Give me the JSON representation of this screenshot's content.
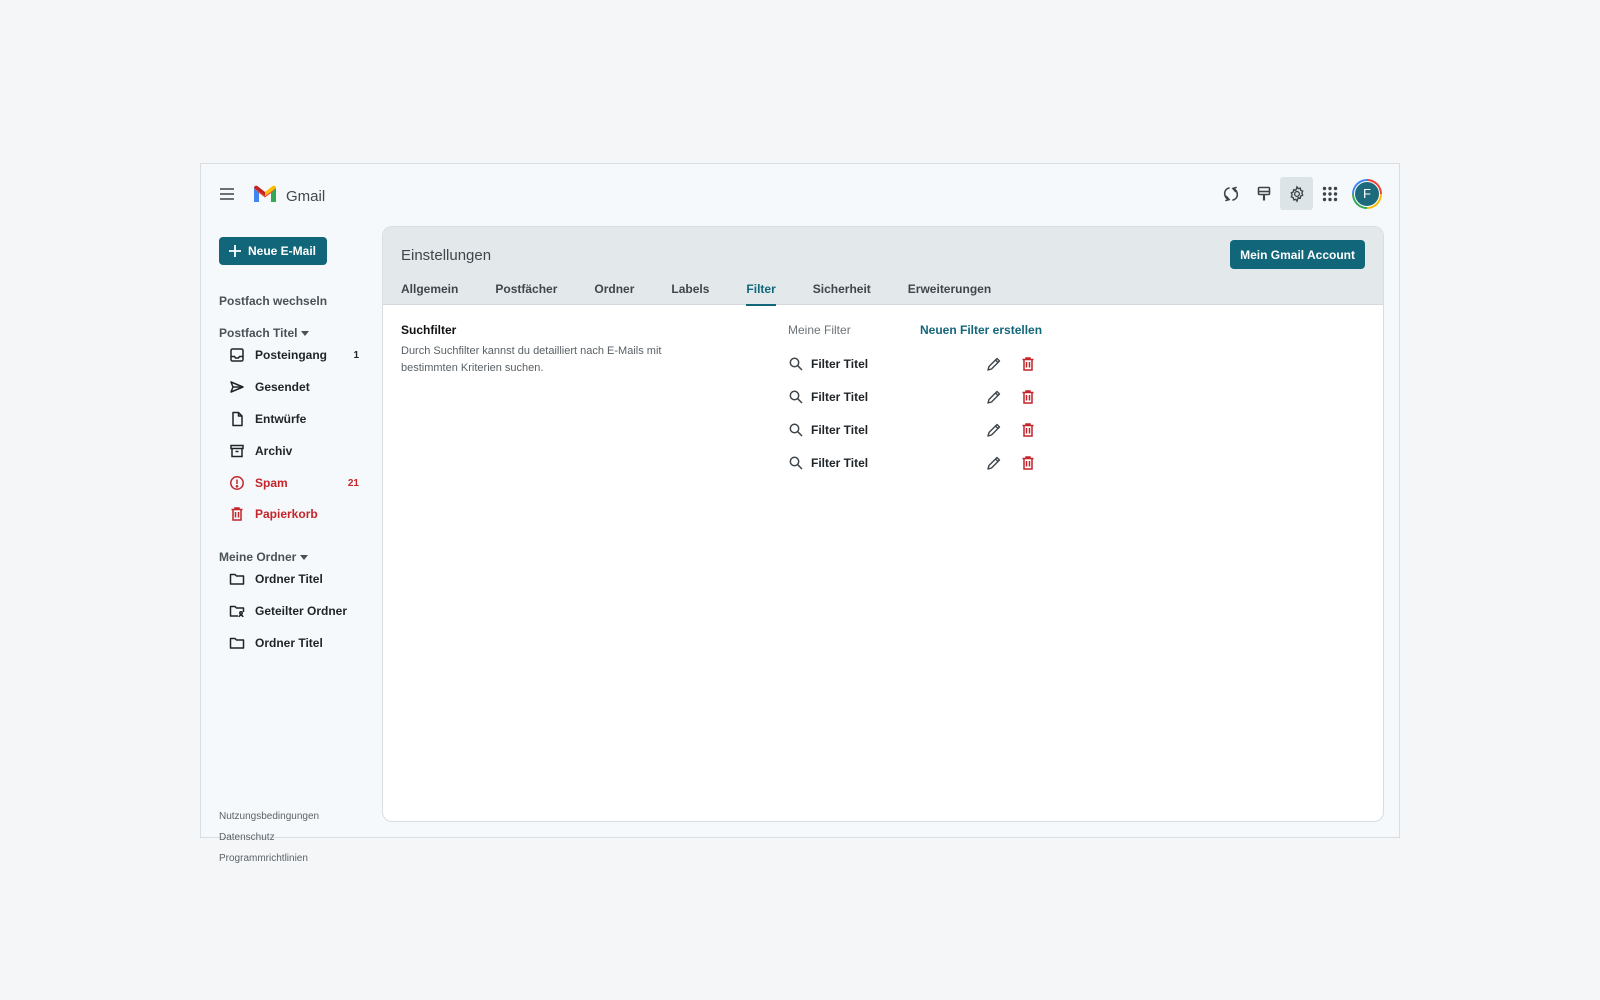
{
  "app": {
    "name": "Gmail"
  },
  "header": {
    "actions": [
      {
        "name": "sync-icon"
      },
      {
        "name": "paint-icon"
      },
      {
        "name": "gear-icon",
        "active": true
      },
      {
        "name": "apps-grid-icon"
      }
    ],
    "avatar_initial": "F"
  },
  "sidebar": {
    "compose_label": "Neue E-Mail",
    "switch_label": "Postfach wechseln",
    "mailbox_heading": "Postfach Titel",
    "mailbox_items": [
      {
        "label": "Posteingang",
        "icon": "inbox-icon",
        "count": "1"
      },
      {
        "label": "Gesendet",
        "icon": "send-icon",
        "count": ""
      },
      {
        "label": "Entwürfe",
        "icon": "draft-icon",
        "count": ""
      },
      {
        "label": "Archiv",
        "icon": "archive-icon",
        "count": ""
      },
      {
        "label": "Spam",
        "icon": "spam-icon",
        "count": "21"
      },
      {
        "label": "Papierkorb",
        "icon": "trash-icon",
        "count": ""
      }
    ],
    "folders_heading": "Meine Ordner",
    "folders": [
      {
        "label": "Ordner Titel",
        "icon": "folder-icon"
      },
      {
        "label": "Geteilter Ordner",
        "icon": "shared-folder-icon"
      },
      {
        "label": "Ordner Titel",
        "icon": "folder-icon"
      }
    ],
    "footer_links": [
      "Nutzungsbedingungen",
      "Datenschutz",
      "Programmrichtlinien"
    ]
  },
  "settings": {
    "title": "Einstellungen",
    "account_button": "Mein Gmail Account",
    "tabs": [
      "Allgemein",
      "Postfächer",
      "Ordner",
      "Labels",
      "Filter",
      "Sicherheit",
      "Erweiterungen"
    ],
    "active_tab": "Filter",
    "section_title": "Suchfilter",
    "section_description": "Durch Suchfilter kannst du detailliert nach E-Mails mit bestimmten Kriterien suchen.",
    "filters_label": "Meine Filter",
    "new_filter_label": "Neuen Filter erstellen",
    "filters": [
      "Filter Titel",
      "Filter Titel",
      "Filter Titel",
      "Filter Titel"
    ]
  },
  "colors": {
    "accent": "#12667a",
    "danger": "#c4242a"
  }
}
